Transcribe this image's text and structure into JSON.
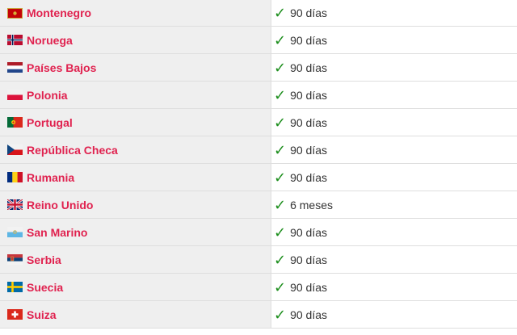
{
  "rows": [
    {
      "country": "Montenegro",
      "stay": "90 días",
      "flag": "montenegro-flag-icon"
    },
    {
      "country": "Noruega",
      "stay": "90 días",
      "flag": "norway-flag-icon"
    },
    {
      "country": "Países Bajos",
      "stay": "90 días",
      "flag": "netherlands-flag-icon"
    },
    {
      "country": "Polonia",
      "stay": "90 días",
      "flag": "poland-flag-icon"
    },
    {
      "country": "Portugal",
      "stay": "90 días",
      "flag": "portugal-flag-icon"
    },
    {
      "country": "República Checa",
      "stay": "90 días",
      "flag": "czech-flag-icon"
    },
    {
      "country": "Rumania",
      "stay": "90 días",
      "flag": "romania-flag-icon"
    },
    {
      "country": "Reino Unido",
      "stay": "6 meses",
      "flag": "uk-flag-icon"
    },
    {
      "country": "San Marino",
      "stay": "90 días",
      "flag": "san-marino-flag-icon"
    },
    {
      "country": "Serbia",
      "stay": "90 días",
      "flag": "serbia-flag-icon"
    },
    {
      "country": "Suecia",
      "stay": "90 días",
      "flag": "sweden-flag-icon"
    },
    {
      "country": "Suiza",
      "stay": "90 días",
      "flag": "switzerland-flag-icon"
    }
  ],
  "check_icon": "checkmark-icon",
  "colors": {
    "link": "#e0224f",
    "check": "#1e8f1e",
    "country_cell_bg": "#efefef",
    "border": "#dedede"
  }
}
